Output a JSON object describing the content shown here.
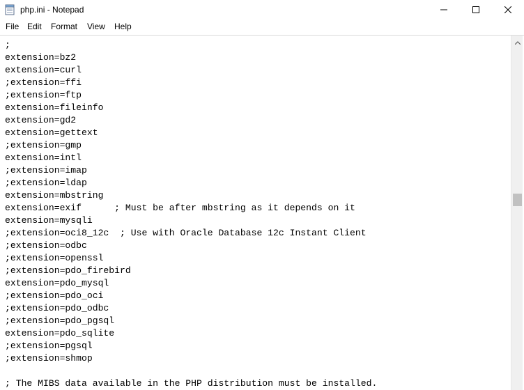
{
  "window": {
    "title": "php.ini - Notepad",
    "icons": {
      "app": "notepad-icon",
      "minimize": "minimize-icon",
      "maximize": "maximize-icon",
      "close": "close-icon"
    }
  },
  "menu": {
    "file": "File",
    "edit": "Edit",
    "format": "Format",
    "view": "View",
    "help": "Help"
  },
  "editor": {
    "lines": [
      ";",
      "extension=bz2",
      "extension=curl",
      ";extension=ffi",
      ";extension=ftp",
      "extension=fileinfo",
      "extension=gd2",
      "extension=gettext",
      ";extension=gmp",
      "extension=intl",
      ";extension=imap",
      ";extension=ldap",
      "extension=mbstring",
      "extension=exif      ; Must be after mbstring as it depends on it",
      "extension=mysqli",
      ";extension=oci8_12c  ; Use with Oracle Database 12c Instant Client",
      ";extension=odbc",
      ";extension=openssl",
      ";extension=pdo_firebird",
      "extension=pdo_mysql",
      ";extension=pdo_oci",
      ";extension=pdo_odbc",
      ";extension=pdo_pgsql",
      "extension=pdo_sqlite",
      ";extension=pgsql",
      ";extension=shmop",
      "",
      "; The MIBS data available in the PHP distribution must be installed."
    ]
  },
  "scrollbar": {
    "position": 0.45,
    "icons": {
      "up": "scroll-up-arrow-icon"
    }
  }
}
